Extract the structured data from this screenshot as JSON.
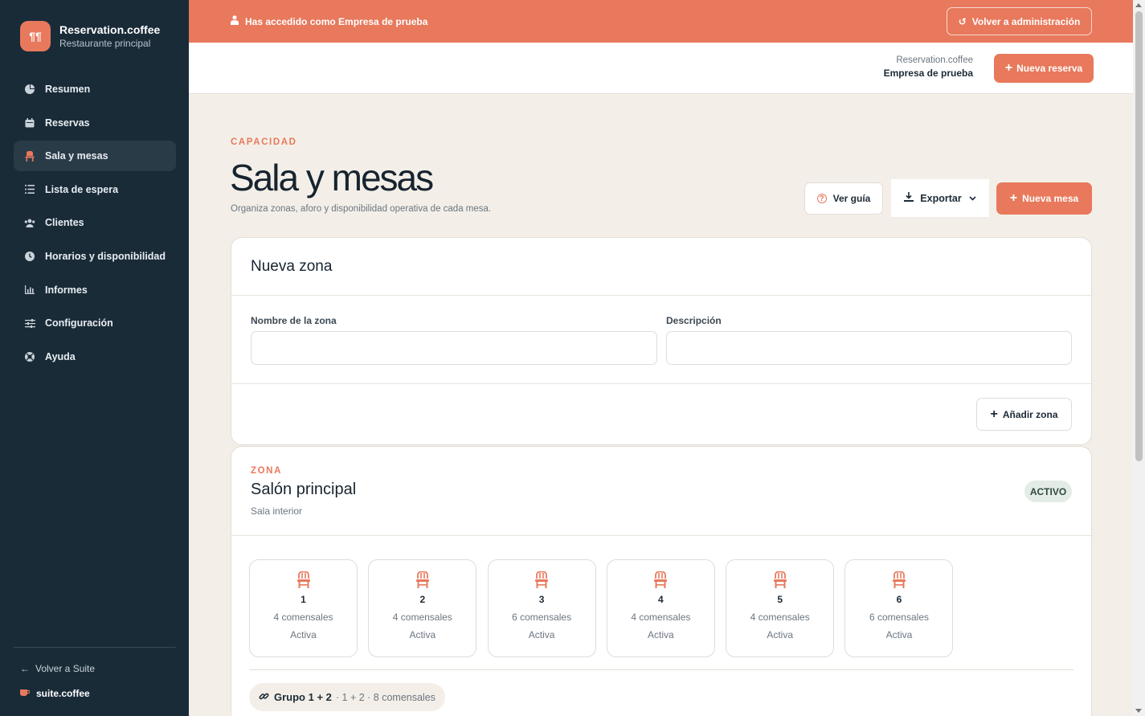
{
  "brand": {
    "logo_glyph": "¶¶",
    "name": "Reservation.coffee",
    "subtitle": "Restaurante principal"
  },
  "sidebar": {
    "items": [
      {
        "label": "Resumen",
        "icon": "pie-chart-icon",
        "active": false
      },
      {
        "label": "Reservas",
        "icon": "calendar-icon",
        "active": false
      },
      {
        "label": "Sala y mesas",
        "icon": "chair-icon",
        "active": true
      },
      {
        "label": "Lista de espera",
        "icon": "list-icon",
        "active": false
      },
      {
        "label": "Clientes",
        "icon": "users-icon",
        "active": false
      },
      {
        "label": "Horarios y disponibilidad",
        "icon": "clock-icon",
        "active": false
      },
      {
        "label": "Informes",
        "icon": "bar-chart-icon",
        "active": false
      },
      {
        "label": "Configuración",
        "icon": "sliders-icon",
        "active": false
      },
      {
        "label": "Ayuda",
        "icon": "help-icon",
        "active": false
      }
    ],
    "back_label": "Volver a Suite",
    "suite_label": "suite.coffee"
  },
  "banner": {
    "text": "Has accedido como Empresa de prueba",
    "admin_button": "Volver a administración"
  },
  "header": {
    "app_name": "Reservation.coffee",
    "org_name": "Empresa de prueba",
    "new_reservation": "Nueva reserva"
  },
  "page": {
    "eyebrow": "CAPACIDAD",
    "title": "Sala y mesas",
    "description": "Organiza zonas, aforo y disponibilidad operativa de cada mesa.",
    "guide_button": "Ver guía",
    "export_button": "Exportar",
    "new_table_button": "Nueva mesa"
  },
  "new_zone": {
    "title": "Nueva zona",
    "name_label": "Nombre de la zona",
    "name_value": "",
    "desc_label": "Descripción",
    "desc_value": "",
    "add_button": "Añadir zona"
  },
  "zone": {
    "eyebrow": "ZONA",
    "name": "Salón principal",
    "description": "Sala interior",
    "status": "ACTIVO",
    "tables": [
      {
        "number": "1",
        "capacity": "4 comensales",
        "status": "Activa"
      },
      {
        "number": "2",
        "capacity": "4 comensales",
        "status": "Activa"
      },
      {
        "number": "3",
        "capacity": "6 comensales",
        "status": "Activa"
      },
      {
        "number": "4",
        "capacity": "4 comensales",
        "status": "Activa"
      },
      {
        "number": "5",
        "capacity": "4 comensales",
        "status": "Activa"
      },
      {
        "number": "6",
        "capacity": "6 comensales",
        "status": "Activa"
      }
    ],
    "group": {
      "name": "Grupo 1 + 2",
      "detail": "· 1 + 2 · 8 comensales"
    }
  },
  "colors": {
    "accent": "#e8795c",
    "sidebar": "#1a2b38",
    "background": "#f3efe8"
  }
}
